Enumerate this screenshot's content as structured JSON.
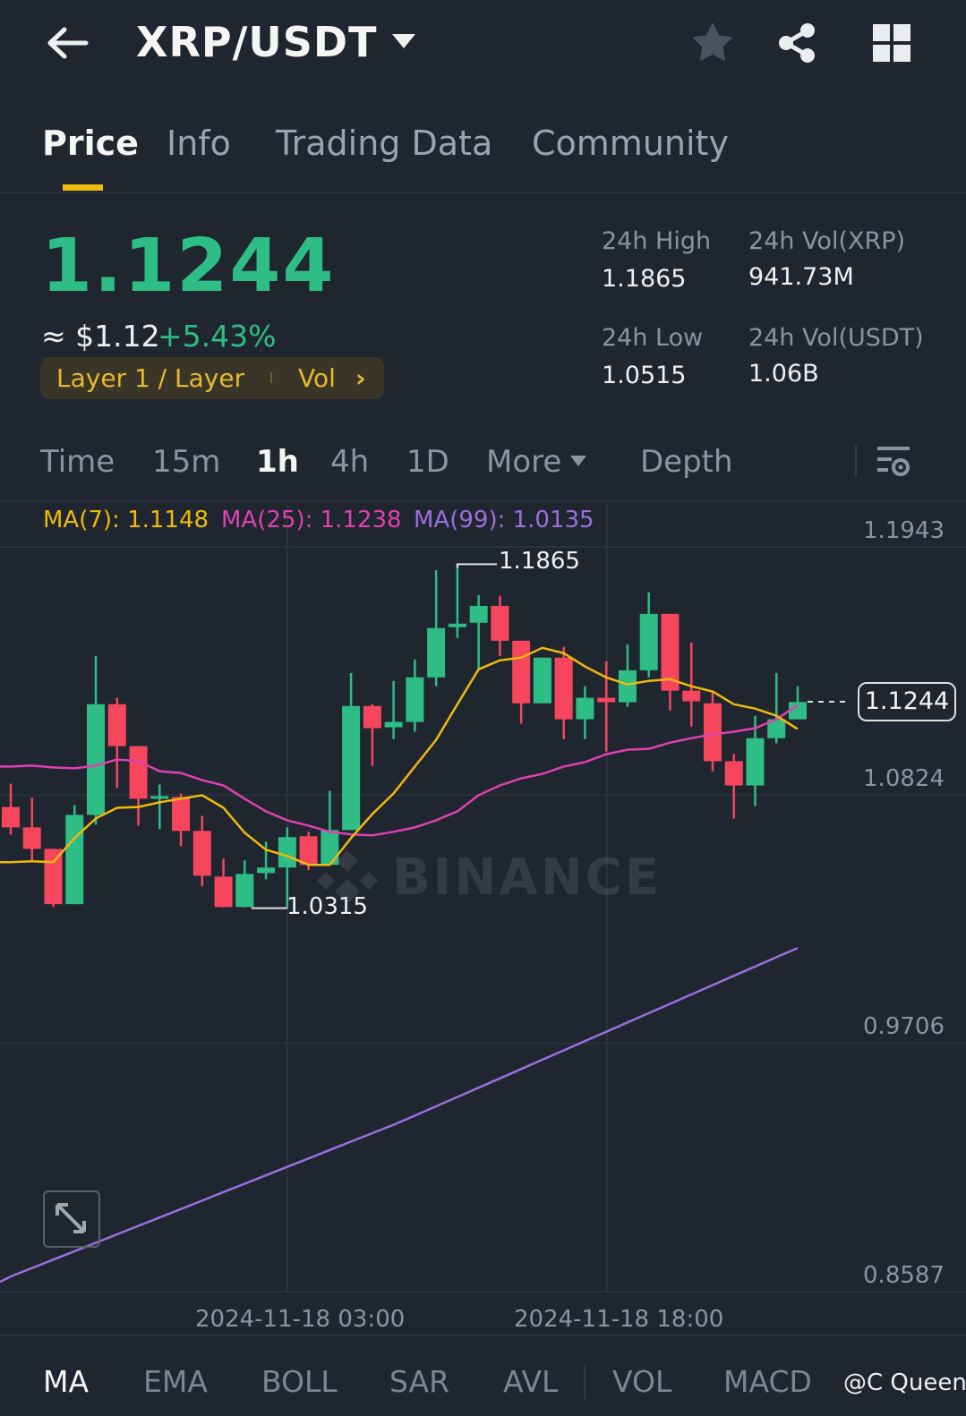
{
  "header": {
    "title": "XRP/USDT",
    "icons": [
      "back-arrow-icon",
      "caret-down-icon",
      "star-icon",
      "share-icon",
      "grid-icon"
    ]
  },
  "tabs": [
    {
      "label": "Price",
      "active": true
    },
    {
      "label": "Info"
    },
    {
      "label": "Trading Data"
    },
    {
      "label": "Community"
    }
  ],
  "summary": {
    "last_price": "1.1244",
    "approx_usd": "≈ $1.12",
    "change_pct": "+5.43%",
    "tag_label": "Layer 1 / Layer",
    "tag_vol": "Vol",
    "high_label": "24h High",
    "high_value": "1.1865",
    "low_label": "24h Low",
    "low_value": "1.0515",
    "vol_xrp_label": "24h Vol(XRP)",
    "vol_xrp_value": "941.73M",
    "vol_usdt_label": "24h Vol(USDT)",
    "vol_usdt_value": "1.06B"
  },
  "intervals": {
    "items": [
      "Time",
      "15m",
      "1h",
      "4h",
      "1D",
      "More",
      "Depth"
    ],
    "active": "1h"
  },
  "colors": {
    "up": "#2ebd85",
    "down": "#f6465d",
    "ma7": "#f0b90b",
    "ma25": "#e040b0",
    "ma99": "#9b6fdc",
    "accent": "#f0b90b"
  },
  "chart_data": {
    "type": "candlestick",
    "interval": "1h",
    "legend": {
      "ma7": "MA(7): 1.1148",
      "ma25": "MA(25): 1.1238",
      "ma99": "MA(99): 1.0135"
    },
    "y_ticks": [
      "1.1943",
      "1.0824",
      "0.9706",
      "0.8587"
    ],
    "y_range": [
      0.8587,
      1.1943
    ],
    "x_ticks": [
      "2024-11-18 03:00",
      "2024-11-18 18:00"
    ],
    "high_annotation": "1.1865",
    "low_annotation": "1.0315",
    "current_price": "1.1244",
    "watermark": "BINANCE",
    "ohlc": [
      [
        1.0771,
        1.0876,
        1.0647,
        1.0679
      ],
      [
        1.0679,
        1.0812,
        1.0526,
        1.0582
      ],
      [
        1.0582,
        1.0582,
        1.032,
        1.0333
      ],
      [
        1.0333,
        1.078,
        1.0333,
        1.0735
      ],
      [
        1.0735,
        1.1452,
        1.0691,
        1.1234
      ],
      [
        1.1234,
        1.1263,
        1.0856,
        1.1045
      ],
      [
        1.1045,
        1.1045,
        1.0687,
        1.0808
      ],
      [
        1.0808,
        1.0872,
        1.0671,
        1.082
      ],
      [
        1.0816,
        1.0832,
        1.0594,
        1.0663
      ],
      [
        1.0663,
        1.0731,
        1.0413,
        1.0461
      ],
      [
        1.0457,
        1.0538,
        1.0318,
        1.032
      ],
      [
        1.032,
        1.053,
        1.0318,
        1.0469
      ],
      [
        1.0473,
        1.0614,
        1.0445,
        1.0498
      ],
      [
        1.0498,
        1.0679,
        1.0315,
        1.0635
      ],
      [
        1.0639,
        1.0659,
        1.0486,
        1.051
      ],
      [
        1.051,
        1.0844,
        1.051,
        1.0667
      ],
      [
        1.0667,
        1.1375,
        1.0667,
        1.1226
      ],
      [
        1.1226,
        1.1234,
        1.0957,
        1.1126
      ],
      [
        1.113,
        1.1339,
        1.1077,
        1.1154
      ],
      [
        1.1154,
        1.1436,
        1.111,
        1.1355
      ],
      [
        1.1355,
        1.1838,
        1.1315,
        1.1577
      ],
      [
        1.1581,
        1.1865,
        1.1532,
        1.1597
      ],
      [
        1.1601,
        1.1726,
        1.1391,
        1.1677
      ],
      [
        1.1677,
        1.1722,
        1.1452,
        1.152
      ],
      [
        1.152,
        1.152,
        1.1146,
        1.1238
      ],
      [
        1.1238,
        1.1444,
        1.1238,
        1.1444
      ],
      [
        1.1444,
        1.1492,
        1.1077,
        1.1166
      ],
      [
        1.1166,
        1.1315,
        1.1077,
        1.1263
      ],
      [
        1.1263,
        1.1428,
        1.1021,
        1.1243
      ],
      [
        1.1243,
        1.1504,
        1.1222,
        1.1387
      ],
      [
        1.1387,
        1.1738,
        1.1355,
        1.1641
      ],
      [
        1.1641,
        1.1641,
        1.1206,
        1.1295
      ],
      [
        1.1295,
        1.1512,
        1.1134,
        1.1247
      ],
      [
        1.1238,
        1.1291,
        1.0932,
        1.0977
      ],
      [
        1.0977,
        1.1009,
        1.0719,
        1.0868
      ],
      [
        1.0868,
        1.1182,
        1.0775,
        1.1081
      ],
      [
        1.1081,
        1.1375,
        1.1057,
        1.1166
      ],
      [
        1.1166,
        1.1315,
        1.1166,
        1.1244
      ]
    ],
    "ma7": [
      1.0522,
      1.0526,
      1.0522,
      1.0631,
      1.0719,
      1.0767,
      1.0771,
      1.0792,
      1.0808,
      1.0824,
      1.0767,
      1.0655,
      1.0578,
      1.055,
      1.051,
      1.051,
      1.0631,
      1.0739,
      1.0832,
      1.0953,
      1.1073,
      1.1234,
      1.1391,
      1.1432,
      1.1444,
      1.1488,
      1.1464,
      1.1404,
      1.1355,
      1.1323,
      1.1339,
      1.1347,
      1.1315,
      1.1291,
      1.1234,
      1.1214,
      1.1182,
      1.1122
    ],
    "ma25": [
      1.0953,
      1.0957,
      1.0949,
      1.0945,
      1.0957,
      1.0985,
      1.0977,
      1.0932,
      1.0924,
      1.0892,
      1.0868,
      1.0808,
      1.0751,
      1.0711,
      1.0687,
      1.0659,
      1.0647,
      1.0643,
      1.0659,
      1.0679,
      1.0711,
      1.0751,
      1.0824,
      1.0868,
      1.09,
      1.092,
      1.0953,
      1.0973,
      1.1009,
      1.1029,
      1.1033,
      1.1061,
      1.1081,
      1.1098,
      1.111,
      1.1126,
      1.1166,
      1.123
    ],
    "ma99": [
      0.8655,
      0.8693,
      0.8731,
      0.8769,
      0.8807,
      0.8845,
      0.8883,
      0.8921,
      0.8959,
      0.8997,
      0.9035,
      0.9073,
      0.9111,
      0.9149,
      0.9187,
      0.9225,
      0.9263,
      0.9301,
      0.9339,
      0.938,
      0.9422,
      0.9464,
      0.9506,
      0.9548,
      0.959,
      0.9632,
      0.9674,
      0.9716,
      0.9758,
      0.98,
      0.9842,
      0.9884,
      0.9926,
      0.9968,
      1.001,
      1.0052,
      1.0094,
      1.0135
    ]
  },
  "indicators": {
    "items": [
      "MA",
      "EMA",
      "BOLL",
      "SAR",
      "AVL",
      "VOL",
      "MACD"
    ],
    "active": "MA"
  },
  "watermark_user": "@C Queen"
}
